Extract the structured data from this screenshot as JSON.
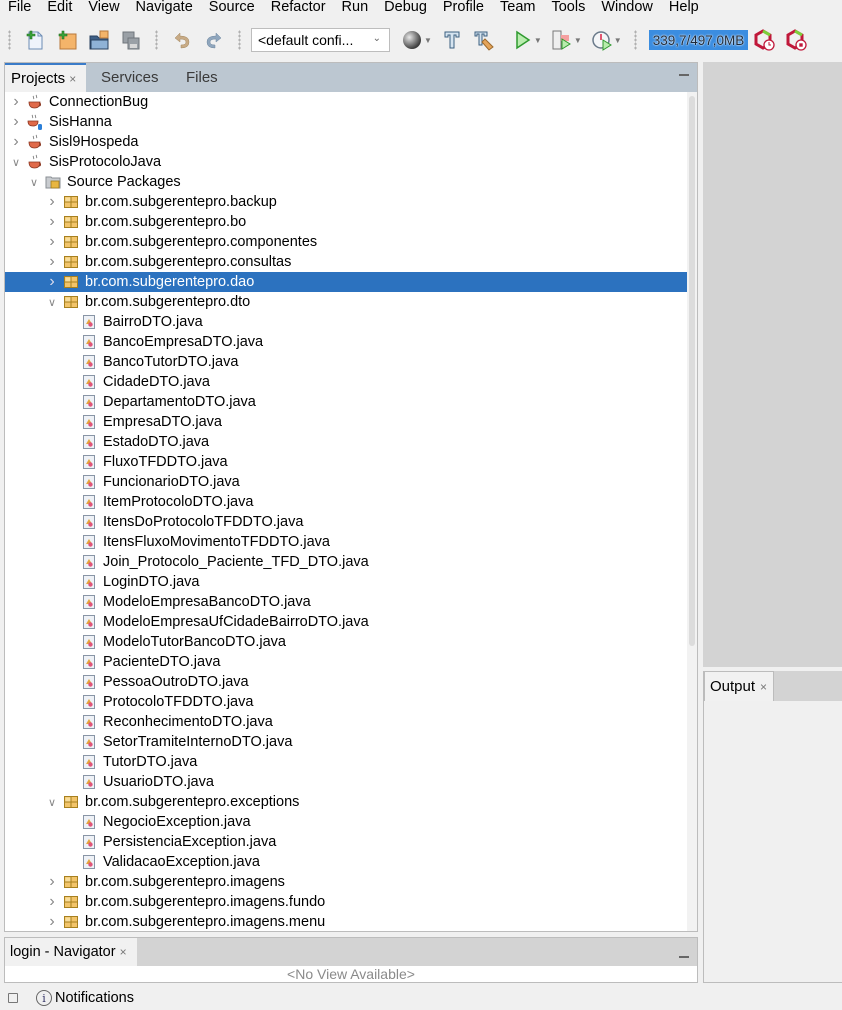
{
  "menu": [
    "File",
    "Edit",
    "View",
    "Navigate",
    "Source",
    "Refactor",
    "Run",
    "Debug",
    "Profile",
    "Team",
    "Tools",
    "Window",
    "Help"
  ],
  "toolbar": {
    "new_file": "new-file-icon",
    "new_project": "new-project-icon",
    "open_project": "open-project-icon",
    "save_all": "save-all-icon",
    "undo": "undo-icon",
    "redo": "redo-icon",
    "config_select": "<default confi...",
    "memory": "339,7/497,0MB",
    "colors": {
      "memory_bar": "#3b8de0",
      "selection": "#2c72bf",
      "tab_strip": "#bcc7d1"
    }
  },
  "projects_panel": {
    "tabs": [
      {
        "label": "Projects",
        "close": "×",
        "active": true
      },
      {
        "label": "Services",
        "active": false
      },
      {
        "label": "Files",
        "active": false
      }
    ],
    "tree": [
      {
        "level": 0,
        "type": "project",
        "arrow": "collapsed",
        "label": "ConnectionBug"
      },
      {
        "level": 0,
        "type": "project-db",
        "arrow": "collapsed",
        "label": "SisHanna"
      },
      {
        "level": 0,
        "type": "project",
        "arrow": "collapsed",
        "label": "Sisl9Hospeda"
      },
      {
        "level": 0,
        "type": "project",
        "arrow": "expanded",
        "label": "SisProtocoloJava"
      },
      {
        "level": 1,
        "type": "source-root",
        "arrow": "expanded",
        "label": "Source Packages"
      },
      {
        "level": 2,
        "type": "package",
        "arrow": "collapsed",
        "label": "br.com.subgerentepro.backup"
      },
      {
        "level": 2,
        "type": "package",
        "arrow": "collapsed",
        "label": "br.com.subgerentepro.bo"
      },
      {
        "level": 2,
        "type": "package",
        "arrow": "collapsed",
        "label": "br.com.subgerentepro.componentes"
      },
      {
        "level": 2,
        "type": "package",
        "arrow": "collapsed",
        "label": "br.com.subgerentepro.consultas"
      },
      {
        "level": 2,
        "type": "package",
        "arrow": "collapsed",
        "label": "br.com.subgerentepro.dao",
        "selected": true
      },
      {
        "level": 2,
        "type": "package",
        "arrow": "expanded",
        "label": "br.com.subgerentepro.dto"
      },
      {
        "level": 3,
        "type": "java",
        "label": "BairroDTO.java"
      },
      {
        "level": 3,
        "type": "java",
        "label": "BancoEmpresaDTO.java"
      },
      {
        "level": 3,
        "type": "java",
        "label": "BancoTutorDTO.java"
      },
      {
        "level": 3,
        "type": "java",
        "label": "CidadeDTO.java"
      },
      {
        "level": 3,
        "type": "java",
        "label": "DepartamentoDTO.java"
      },
      {
        "level": 3,
        "type": "java",
        "label": "EmpresaDTO.java"
      },
      {
        "level": 3,
        "type": "java",
        "label": "EstadoDTO.java"
      },
      {
        "level": 3,
        "type": "java",
        "label": "FluxoTFDDTO.java"
      },
      {
        "level": 3,
        "type": "java",
        "label": "FuncionarioDTO.java"
      },
      {
        "level": 3,
        "type": "java",
        "label": "ItemProtocoloDTO.java"
      },
      {
        "level": 3,
        "type": "java",
        "label": "ItensDoProtocoloTFDDTO.java"
      },
      {
        "level": 3,
        "type": "java",
        "label": "ItensFluxoMovimentoTFDDTO.java"
      },
      {
        "level": 3,
        "type": "java",
        "label": "Join_Protocolo_Paciente_TFD_DTO.java"
      },
      {
        "level": 3,
        "type": "java",
        "label": "LoginDTO.java"
      },
      {
        "level": 3,
        "type": "java",
        "label": "ModeloEmpresaBancoDTO.java"
      },
      {
        "level": 3,
        "type": "java",
        "label": "ModeloEmpresaUfCidadeBairroDTO.java"
      },
      {
        "level": 3,
        "type": "java",
        "label": "ModeloTutorBancoDTO.java"
      },
      {
        "level": 3,
        "type": "java",
        "label": "PacienteDTO.java"
      },
      {
        "level": 3,
        "type": "java",
        "label": "PessoaOutroDTO.java"
      },
      {
        "level": 3,
        "type": "java",
        "label": "ProtocoloTFDDTO.java"
      },
      {
        "level": 3,
        "type": "java",
        "label": "ReconhecimentoDTO.java"
      },
      {
        "level": 3,
        "type": "java",
        "label": "SetorTramiteInternoDTO.java"
      },
      {
        "level": 3,
        "type": "java",
        "label": "TutorDTO.java"
      },
      {
        "level": 3,
        "type": "java",
        "label": "UsuarioDTO.java"
      },
      {
        "level": 2,
        "type": "package",
        "arrow": "expanded",
        "label": "br.com.subgerentepro.exceptions"
      },
      {
        "level": 3,
        "type": "java",
        "label": "NegocioException.java"
      },
      {
        "level": 3,
        "type": "java",
        "label": "PersistenciaException.java"
      },
      {
        "level": 3,
        "type": "java",
        "label": "ValidacaoException.java"
      },
      {
        "level": 2,
        "type": "package",
        "arrow": "collapsed",
        "label": "br.com.subgerentepro.imagens"
      },
      {
        "level": 2,
        "type": "package",
        "arrow": "collapsed",
        "label": "br.com.subgerentepro.imagens.fundo"
      },
      {
        "level": 2,
        "type": "package",
        "arrow": "collapsed",
        "label": "br.com.subgerentepro.imagens.menu"
      }
    ]
  },
  "output_panel": {
    "tab_label": "Output",
    "close": "×"
  },
  "navigator_panel": {
    "tab_label": "login - Navigator",
    "close": "×",
    "empty_text": "<No View Available>"
  },
  "statusbar": {
    "notifications_label": "Notifications"
  }
}
